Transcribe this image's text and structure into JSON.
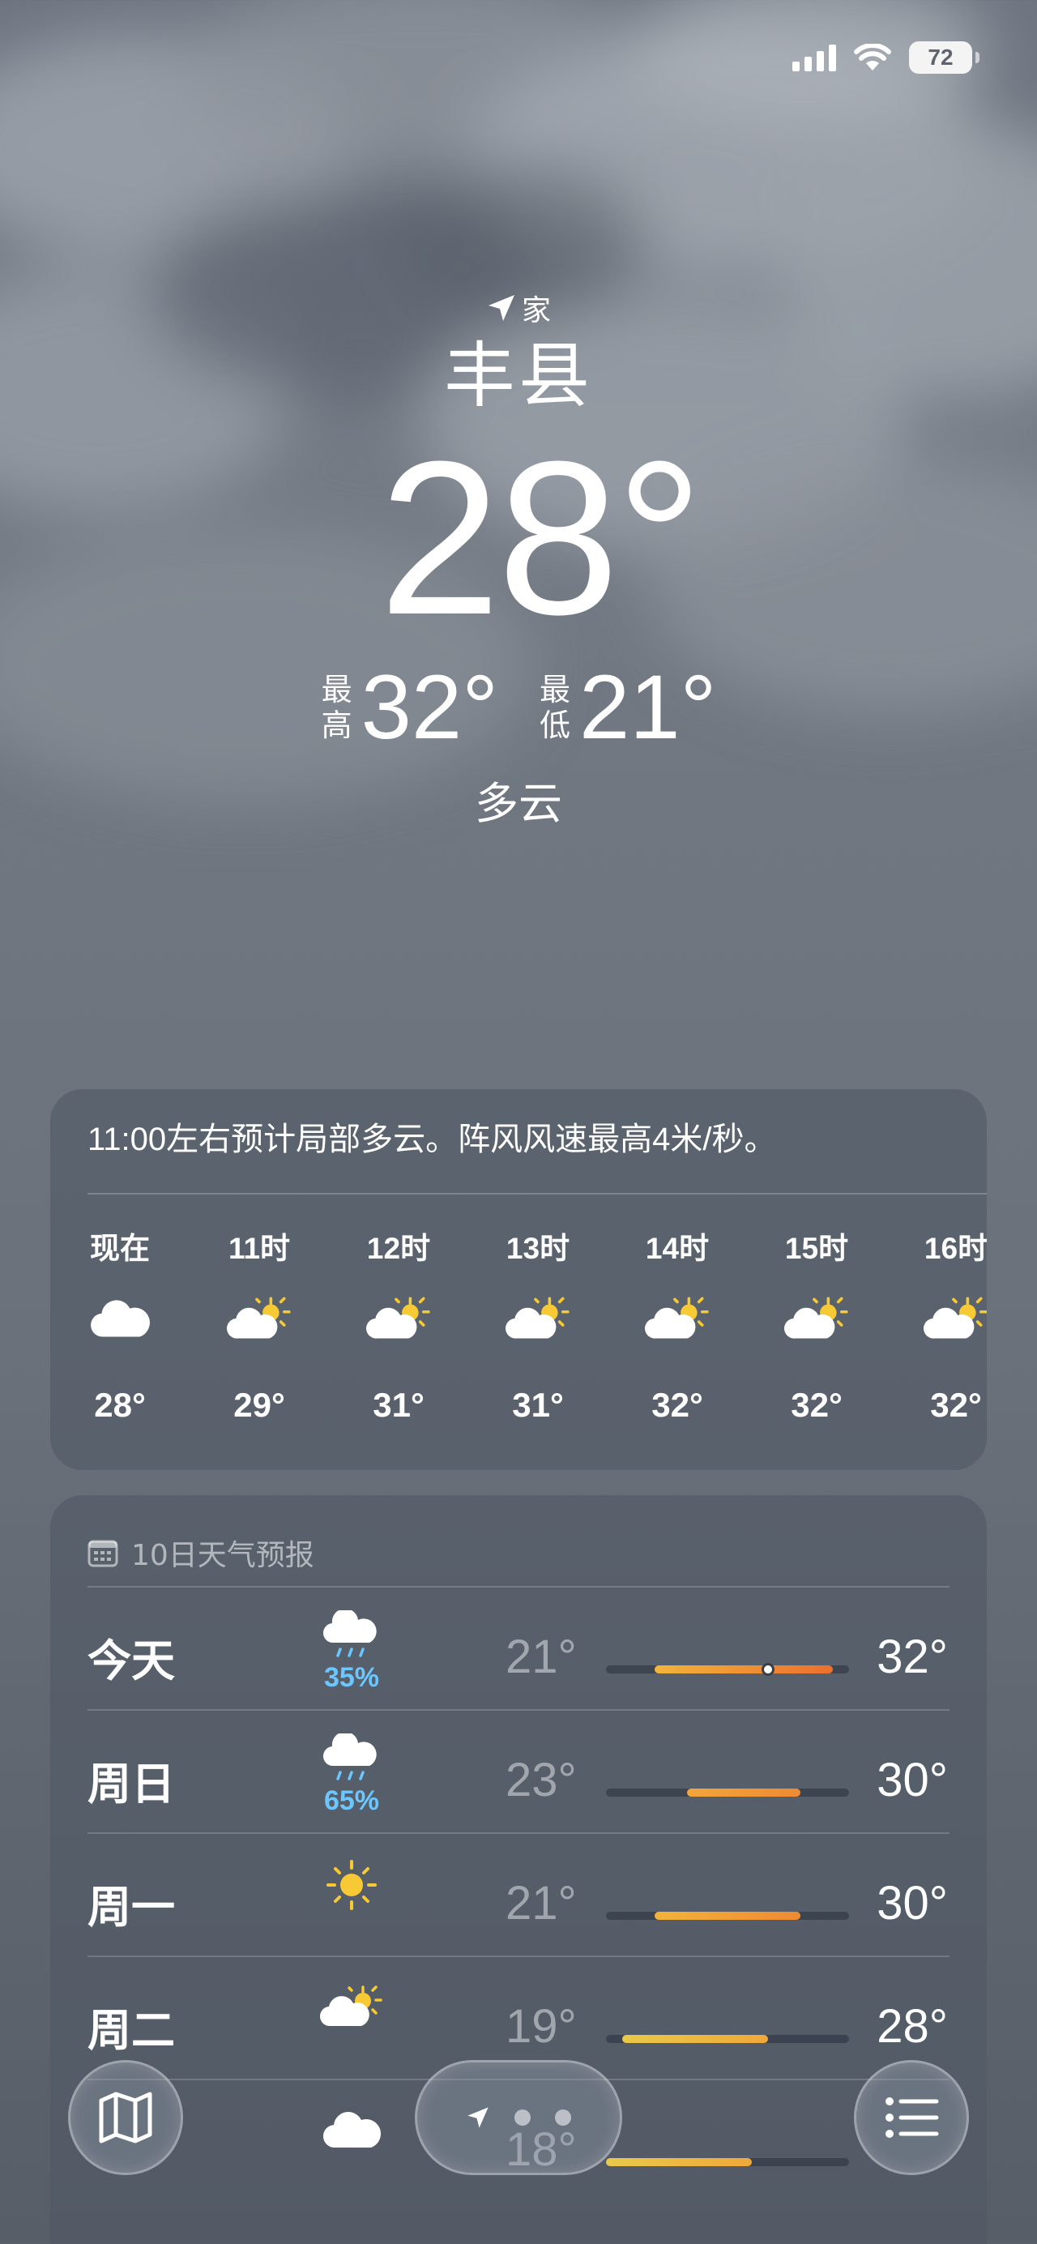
{
  "status_bar": {
    "battery": "72"
  },
  "header": {
    "location_tag": "家",
    "city": "丰县",
    "current_temp": "28°",
    "high_label": "最高",
    "high": "32°",
    "low_label": "最低",
    "low": "21°",
    "condition": "多云"
  },
  "hourly": {
    "summary": "11:00左右预计局部多云。阵风风速最高4米/秒。",
    "items": [
      {
        "label": "现在",
        "icon": "cloud-icon",
        "temp": "28°"
      },
      {
        "label": "11时",
        "icon": "partly-sunny-icon",
        "temp": "29°"
      },
      {
        "label": "12时",
        "icon": "partly-sunny-icon",
        "temp": "31°"
      },
      {
        "label": "13时",
        "icon": "partly-sunny-icon",
        "temp": "31°"
      },
      {
        "label": "14时",
        "icon": "partly-sunny-icon",
        "temp": "32°"
      },
      {
        "label": "15时",
        "icon": "partly-sunny-icon",
        "temp": "32°"
      },
      {
        "label": "16时",
        "icon": "partly-sunny-icon",
        "temp": "32°"
      }
    ]
  },
  "daily": {
    "title": "10日天气预报",
    "range": [
      18,
      33
    ],
    "items": [
      {
        "day": "今天",
        "icon": "rain-icon",
        "pop": "35%",
        "low": "21°",
        "high": "32°",
        "low_val": 21,
        "high_val": 32,
        "current": 28,
        "colors": [
          "#f2b53a",
          "#ec6f2e"
        ]
      },
      {
        "day": "周日",
        "icon": "rain-icon",
        "pop": "65%",
        "low": "23°",
        "high": "30°",
        "low_val": 23,
        "high_val": 30,
        "colors": [
          "#f2a63a",
          "#ee8a33"
        ]
      },
      {
        "day": "周一",
        "icon": "sun-icon",
        "pop": "",
        "low": "21°",
        "high": "30°",
        "low_val": 21,
        "high_val": 30,
        "colors": [
          "#f2b43a",
          "#ee8a33"
        ]
      },
      {
        "day": "周二",
        "icon": "partly-sunny-icon",
        "pop": "",
        "low": "19°",
        "high": "28°",
        "low_val": 19,
        "high_val": 28,
        "colors": [
          "#e9c94a",
          "#f0a83a"
        ]
      },
      {
        "day": "",
        "icon": "cloud-icon",
        "pop": "",
        "low": "18°",
        "high": "",
        "low_val": 18,
        "high_val": 27,
        "colors": [
          "#e9c94a",
          "#f0a83a"
        ]
      }
    ]
  },
  "toolbar": {
    "map_icon": "map-icon",
    "location_icon": "location-arrow-icon",
    "list_icon": "list-icon"
  }
}
